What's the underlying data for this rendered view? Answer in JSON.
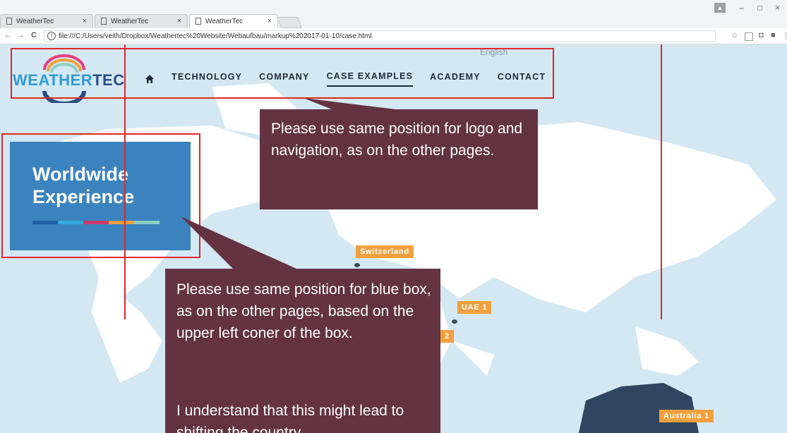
{
  "browser": {
    "tabs": [
      {
        "title": "WeatherTec",
        "close": "×"
      },
      {
        "title": "WeatherTec",
        "close": "×"
      },
      {
        "title": "WeatherTec",
        "close": "×"
      }
    ],
    "url": "file:///C:/Users/veith/Dropbox/Weathertec%20Website/Webaufbau/markup%202017-01-10/case.html",
    "back": "←",
    "forward": "→",
    "reload": "C",
    "star": "☆",
    "window_controls": {
      "minimize": "–",
      "maximize": "□",
      "close": "×"
    },
    "menu": "⋮"
  },
  "site": {
    "logo": {
      "part1": "WEATHER",
      "part2": "TEC"
    },
    "nav": [
      "TECHNOLOGY",
      "COMPANY",
      "CASE EXAMPLES",
      "ACADEMY",
      "CONTACT"
    ],
    "active_nav": "CASE EXAMPLES",
    "language": "English",
    "hero": {
      "line1": "Worldwide",
      "line2": "Experience"
    },
    "stripe_colors": [
      "#1f5fa5",
      "#2ea8df",
      "#cc3a6e",
      "#f2a03d",
      "#8fcfc4"
    ]
  },
  "map_labels": [
    {
      "label": "Switzerland"
    },
    {
      "label": "UAE 1"
    },
    {
      "label": "2"
    },
    {
      "label": "Australia 1"
    }
  ],
  "annotations": {
    "callout1": "Please use same position for logo and navigation, as on the other pages.",
    "callout2_p1": "Please use same position for blue box, as on the other pages,  based on the upper left coner of the box.",
    "callout2_p2": "I understand that this might lead to shifting the country"
  },
  "colors": {
    "accent": "#e0262c",
    "callout": "#633342",
    "tag": "#f2a03d",
    "hero": "#3b83be"
  }
}
